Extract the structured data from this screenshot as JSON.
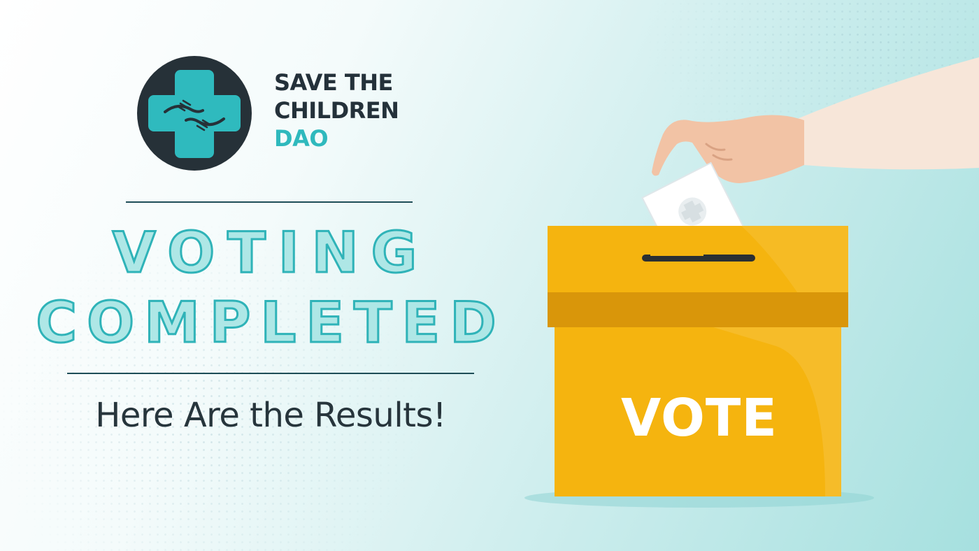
{
  "brand": {
    "line1": "SAVE THE",
    "line2": "CHILDREN",
    "line3": "DAO"
  },
  "headline": {
    "line1": "VOTING",
    "line2": "COMPLETED"
  },
  "subtitle": "Here Are the Results!",
  "ballot_box": {
    "label": "VOTE"
  },
  "colors": {
    "brand_dark": "#24313a",
    "accent_teal": "#2fb9bd",
    "box_yellow": "#f5b40f",
    "box_band": "#d9960a"
  }
}
